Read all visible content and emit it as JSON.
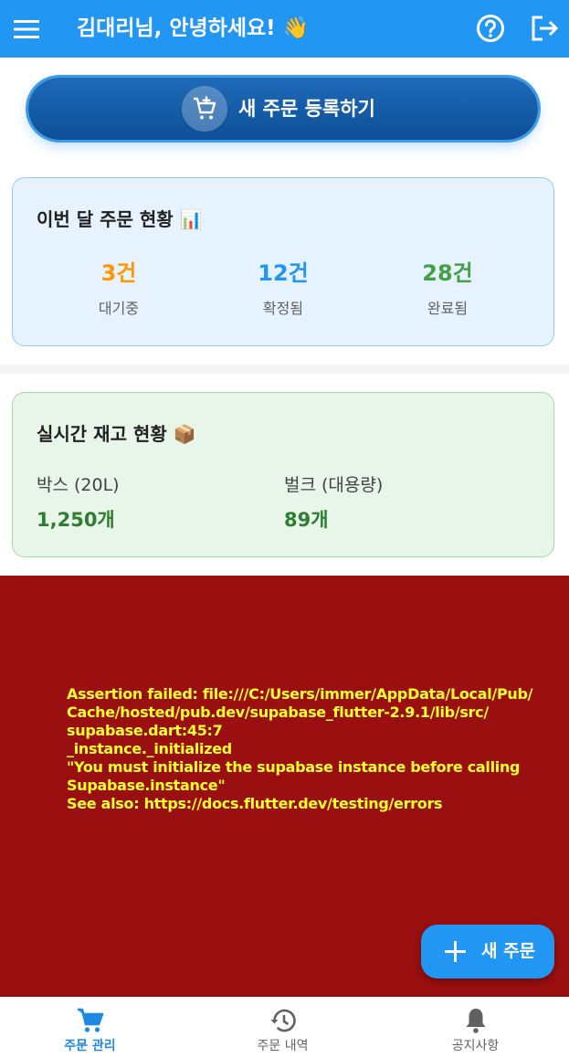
{
  "app_bar": {
    "title": "김대리님, 안녕하세요! 👋",
    "background": "#2196f3"
  },
  "primary_action": {
    "label": "새 주문 등록하기",
    "icon": "add-shopping-cart-icon"
  },
  "orders_card": {
    "title": "이번 달 주문 현황 📊",
    "stats": [
      {
        "value": "3건",
        "label": "대기중",
        "color": "#ff9800"
      },
      {
        "value": "12건",
        "label": "확정됨",
        "color": "#2196f3"
      },
      {
        "value": "28건",
        "label": "완료됨",
        "color": "#43a047"
      }
    ]
  },
  "stock_card": {
    "title": "실시간 재고 현황 📦",
    "items": [
      {
        "name": "박스 (20L)",
        "quantity": "1,250개"
      },
      {
        "name": "벌크 (대용량)",
        "quantity": "89개"
      }
    ]
  },
  "error": {
    "message": "Assertion failed: file:///C:/Users/immer/AppData/Local/Pub/\nCache/hosted/pub.dev/supabase_flutter-2.9.1/lib/src/\nsupabase.dart:45:7\n_instance._initialized\n\"You must initialize the supabase instance before calling\nSupabase.instance\"\nSee also: https://docs.flutter.dev/testing/errors",
    "background": "#9a0f0f",
    "text_color": "#ffff2e"
  },
  "fab": {
    "label": "새 주문",
    "icon": "plus-icon"
  },
  "bottom_nav": {
    "items": [
      {
        "label": "주문 관리",
        "icon": "shopping-cart-icon",
        "active": true
      },
      {
        "label": "주문 내역",
        "icon": "history-icon",
        "active": false
      },
      {
        "label": "공지사항",
        "icon": "bell-icon",
        "active": false
      }
    ]
  }
}
